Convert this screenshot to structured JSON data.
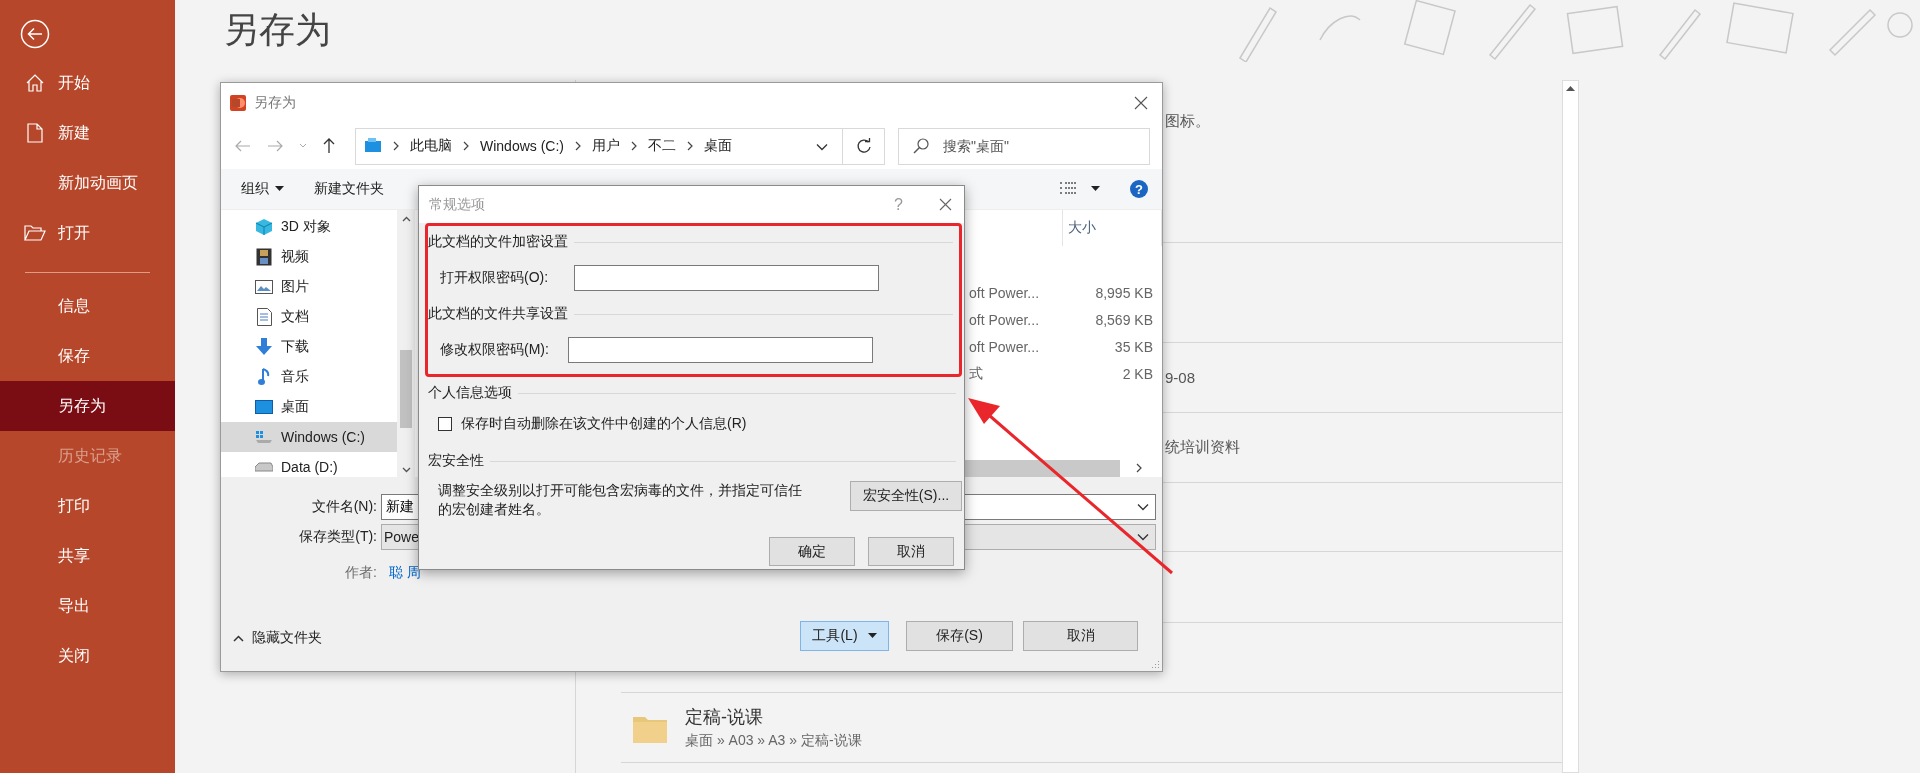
{
  "sidebar": {
    "items": [
      {
        "kind": "home",
        "label": "开始",
        "selected": false,
        "disabled": false
      },
      {
        "kind": "page",
        "label": "新建",
        "selected": false,
        "disabled": false
      },
      {
        "kind": "plain",
        "label": "新加动画页",
        "selected": false,
        "disabled": false
      },
      {
        "kind": "folder",
        "label": "打开",
        "selected": false,
        "disabled": false
      },
      {
        "kind": "divider"
      },
      {
        "kind": "plain",
        "label": "信息",
        "selected": false,
        "disabled": false
      },
      {
        "kind": "plain",
        "label": "保存",
        "selected": false,
        "disabled": false
      },
      {
        "kind": "plain",
        "label": "另存为",
        "selected": true,
        "disabled": false
      },
      {
        "kind": "plain",
        "label": "历史记录",
        "selected": false,
        "disabled": true
      },
      {
        "kind": "plain",
        "label": "打印",
        "selected": false,
        "disabled": false
      },
      {
        "kind": "plain",
        "label": "共享",
        "selected": false,
        "disabled": false
      },
      {
        "kind": "plain",
        "label": "导出",
        "selected": false,
        "disabled": false
      },
      {
        "kind": "plain",
        "label": "关闭",
        "selected": false,
        "disabled": false
      }
    ]
  },
  "page_title": "另存为",
  "recent_list": {
    "rows": [
      {
        "kind": "text",
        "text": "图标。"
      },
      {
        "kind": "blank"
      },
      {
        "kind": "text",
        "text": "9-08"
      },
      {
        "kind": "text",
        "text": "统培训资料"
      },
      {
        "kind": "blank"
      },
      {
        "kind": "blank"
      },
      {
        "kind": "blank"
      },
      {
        "kind": "folder",
        "name": "定稿-说课",
        "path": "桌面 » A03 » A3 » 定稿-说课"
      }
    ]
  },
  "save_dialog": {
    "title": "另存为",
    "breadcrumb": [
      "此电脑",
      "Windows (C:)",
      "用户",
      "不二",
      "桌面"
    ],
    "search": {
      "placeholder": "搜索\"桌面\""
    },
    "organize": "组织",
    "new_folder": "新建文件夹",
    "help": "?",
    "tree": [
      {
        "kind": "cube",
        "label": "3D 对象",
        "selected": false
      },
      {
        "kind": "film",
        "label": "视频",
        "selected": false
      },
      {
        "kind": "image",
        "label": "图片",
        "selected": false
      },
      {
        "kind": "doc",
        "label": "文档",
        "selected": false
      },
      {
        "kind": "download",
        "label": "下载",
        "selected": false
      },
      {
        "kind": "music",
        "label": "音乐",
        "selected": false
      },
      {
        "kind": "desktop",
        "label": "桌面",
        "selected": false
      },
      {
        "kind": "system_drive",
        "label": "Windows (C:)",
        "selected": true
      },
      {
        "kind": "drive",
        "label": "Data (D:)",
        "selected": false
      }
    ],
    "columns": [
      "大小"
    ],
    "files": [
      {
        "type": "oft Power...",
        "size": "8,995 KB"
      },
      {
        "type": "oft Power...",
        "size": "8,569 KB"
      },
      {
        "type": "oft Power...",
        "size": "35 KB"
      },
      {
        "type": "式",
        "size": "2 KB"
      }
    ],
    "filename_label": "文件名(N):",
    "filename": "新建",
    "type_label": "保存类型(T):",
    "type_value": "Powe",
    "author_label": "作者:",
    "author": "聪 周",
    "hide_folders": "隐藏文件夹",
    "tools": "工具(L)",
    "save": "保存(S)",
    "cancel": "取消"
  },
  "options_dialog": {
    "title": "常规选项",
    "help": "?",
    "encryption": {
      "heading": "此文档的文件加密设置",
      "label": "打开权限密码(O):"
    },
    "sharing": {
      "heading": "此文档的文件共享设置",
      "label": "修改权限密码(M):"
    },
    "privacy": {
      "heading": "个人信息选项",
      "checkbox": {
        "label": "保存时自动删除在该文件中创建的个人信息(R)",
        "checked": false
      }
    },
    "macro": {
      "heading": "宏安全性",
      "description": "调整安全级别以打开可能包含宏病毒的文件，并指定可信任的宏创建者姓名。",
      "button": "宏安全性(S)..."
    },
    "buttons": [
      "确定",
      "取消"
    ]
  }
}
